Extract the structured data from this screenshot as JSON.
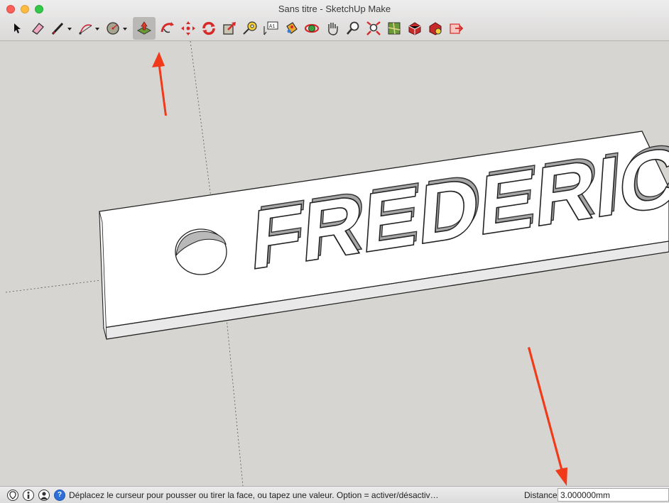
{
  "window": {
    "title": "Sans titre - SketchUp Make"
  },
  "toolbar": {
    "tools": [
      "select",
      "eraser",
      "line",
      "arc",
      "shape",
      "push-pull",
      "follow-me",
      "move",
      "rotate",
      "scale",
      "tape-measure",
      "text",
      "paint-bucket",
      "orbit",
      "pan",
      "zoom",
      "zoom-extents",
      "warehouse",
      "extension-warehouse",
      "layout",
      "send-to-layout"
    ],
    "active_tool": "push-pull"
  },
  "scene": {
    "model_text": "FREDERIC"
  },
  "status": {
    "message": "Déplacez le curseur pour pousser ou tirer la face, ou tapez une valeur. Option = activer/désactiv…",
    "measure_label": "Distance",
    "measure_value": "3.000000mm"
  },
  "colors": {
    "accent_arrow": "#f03a1a",
    "background": "#d6d5d1"
  }
}
